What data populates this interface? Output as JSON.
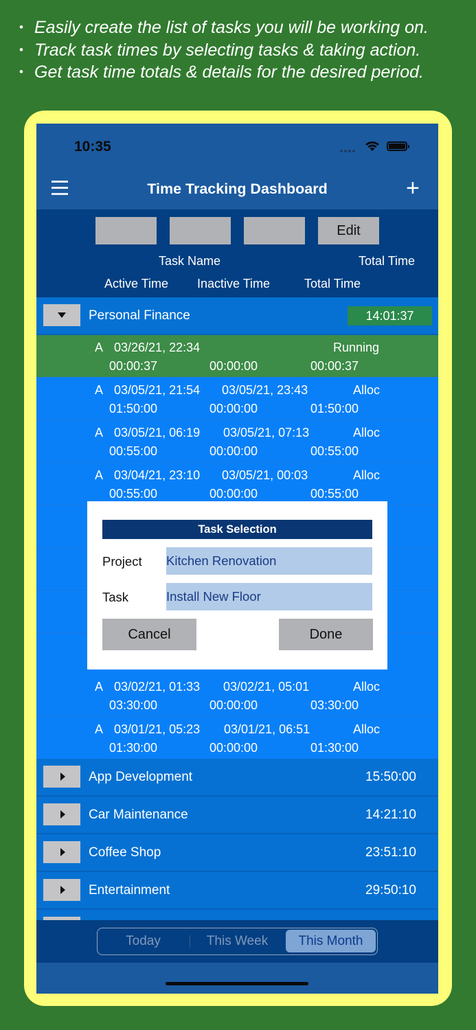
{
  "promo": {
    "lines": [
      "Easily create the list of tasks you will be working on.",
      "Track task times by selecting tasks & taking action.",
      "Get task time totals & details for the desired period."
    ]
  },
  "status_bar": {
    "time": "10:35"
  },
  "nav": {
    "title": "Time Tracking Dashboard",
    "menu_icon": "hamburger-icon",
    "add_icon": "plus-icon"
  },
  "header": {
    "buttons": [
      "",
      "",
      "",
      "Edit"
    ],
    "row1": {
      "task_name": "Task Name",
      "total_time": "Total Time"
    },
    "row2": {
      "active_time": "Active Time",
      "inactive_time": "Inactive Time",
      "total_time": "Total Time"
    }
  },
  "expanded_group": {
    "name": "Personal Finance",
    "total": "14:01:37",
    "badge_color": "#2a8a4b"
  },
  "entries": [
    {
      "type": "A",
      "start": "03/26/21, 22:34",
      "end": "",
      "status": "Running",
      "active": "00:00:37",
      "inactive": "00:00:00",
      "total": "00:00:37"
    },
    {
      "type": "A",
      "start": "03/05/21, 21:54",
      "end": "03/05/21, 23:43",
      "status": "Alloc",
      "active": "01:50:00",
      "inactive": "00:00:00",
      "total": "01:50:00"
    },
    {
      "type": "A",
      "start": "03/05/21, 06:19",
      "end": "03/05/21, 07:13",
      "status": "Alloc",
      "active": "00:55:00",
      "inactive": "00:00:00",
      "total": "00:55:00"
    },
    {
      "type": "A",
      "start": "03/04/21, 23:10",
      "end": "03/05/21, 00:03",
      "status": "Alloc",
      "active": "00:55:00",
      "inactive": "00:00:00",
      "total": "00:55:00"
    },
    {
      "type": "A",
      "start": "03/02/21, 01:33",
      "end": "03/02/21, 05:01",
      "status": "Alloc",
      "active": "03:30:00",
      "inactive": "00:00:00",
      "total": "03:30:00"
    },
    {
      "type": "A",
      "start": "03/01/21, 05:23",
      "end": "03/01/21, 06:51",
      "status": "Alloc",
      "active": "01:30:00",
      "inactive": "00:00:00",
      "total": "01:30:00"
    }
  ],
  "collapsed_groups": [
    {
      "name": "App Development",
      "total": "15:50:00"
    },
    {
      "name": "Car Maintenance",
      "total": "14:21:10"
    },
    {
      "name": "Coffee Shop",
      "total": "23:51:10"
    },
    {
      "name": "Entertainment",
      "total": "29:50:10"
    }
  ],
  "modal": {
    "title": "Task Selection",
    "project_label": "Project",
    "project_value": "Kitchen Renovation",
    "task_label": "Task",
    "task_value": "Install New Floor",
    "cancel": "Cancel",
    "done": "Done"
  },
  "period": {
    "options": [
      "Today",
      "This Week",
      "This Month"
    ],
    "selected": "This Month"
  },
  "colors": {
    "background": "#327a30",
    "frame": "#fcfd79",
    "running_row": "#3d8c48",
    "entry_row": "#0a80f8",
    "header": "#033f82"
  }
}
